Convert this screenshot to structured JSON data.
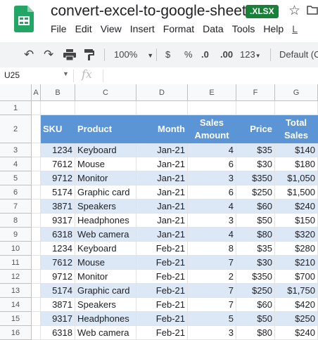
{
  "app": {
    "doc_title": "convert-excel-to-google-sheets",
    "file_badge": ".XLSX",
    "menu": [
      "File",
      "Edit",
      "View",
      "Insert",
      "Format",
      "Data",
      "Tools",
      "Help",
      "L"
    ]
  },
  "toolbar": {
    "zoom": "100%",
    "currency": "$",
    "percent": "%",
    "decrease_decimals": ".0",
    "increase_decimals": ".00",
    "more_formats": "123",
    "font": "Default (Ca"
  },
  "formula_bar": {
    "cell_ref": "U25",
    "fx": "fx"
  },
  "columns": [
    "A",
    "B",
    "C",
    "D",
    "E",
    "F",
    "G"
  ],
  "rows": [
    "1",
    "2",
    "3",
    "4",
    "5",
    "6",
    "7",
    "8",
    "9",
    "10",
    "11",
    "12",
    "13",
    "14",
    "15",
    "16"
  ],
  "table": {
    "headers": [
      "SKU",
      "Product",
      "Month",
      "Sales Amount",
      "Price",
      "Total Sales"
    ],
    "header_sales_line1": "Sales",
    "header_sales_line2": "Amount",
    "header_total_line1": "Total",
    "header_total_line2": "Sales",
    "data": [
      [
        "1234",
        "Keyboard",
        "Jan-21",
        "4",
        "$35",
        "$140"
      ],
      [
        "7612",
        "Mouse",
        "Jan-21",
        "6",
        "$30",
        "$180"
      ],
      [
        "9712",
        "Monitor",
        "Jan-21",
        "3",
        "$350",
        "$1,050"
      ],
      [
        "5174",
        "Graphic card",
        "Jan-21",
        "6",
        "$250",
        "$1,500"
      ],
      [
        "3871",
        "Speakers",
        "Jan-21",
        "4",
        "$60",
        "$240"
      ],
      [
        "9317",
        "Headphones",
        "Jan-21",
        "3",
        "$50",
        "$150"
      ],
      [
        "6318",
        "Web camera",
        "Jan-21",
        "4",
        "$80",
        "$320"
      ],
      [
        "1234",
        "Keyboard",
        "Feb-21",
        "8",
        "$35",
        "$280"
      ],
      [
        "7612",
        "Mouse",
        "Feb-21",
        "7",
        "$30",
        "$210"
      ],
      [
        "9712",
        "Monitor",
        "Feb-21",
        "2",
        "$350",
        "$700"
      ],
      [
        "5174",
        "Graphic card",
        "Feb-21",
        "7",
        "$250",
        "$1,750"
      ],
      [
        "3871",
        "Speakers",
        "Feb-21",
        "7",
        "$60",
        "$420"
      ],
      [
        "9317",
        "Headphones",
        "Feb-21",
        "5",
        "$50",
        "$250"
      ],
      [
        "6318",
        "Web camera",
        "Feb-21",
        "3",
        "$80",
        "$240"
      ]
    ]
  },
  "colors": {
    "header_fill": "#5b95d6",
    "band_fill": "#dce8f6",
    "badge_green": "#188038"
  }
}
